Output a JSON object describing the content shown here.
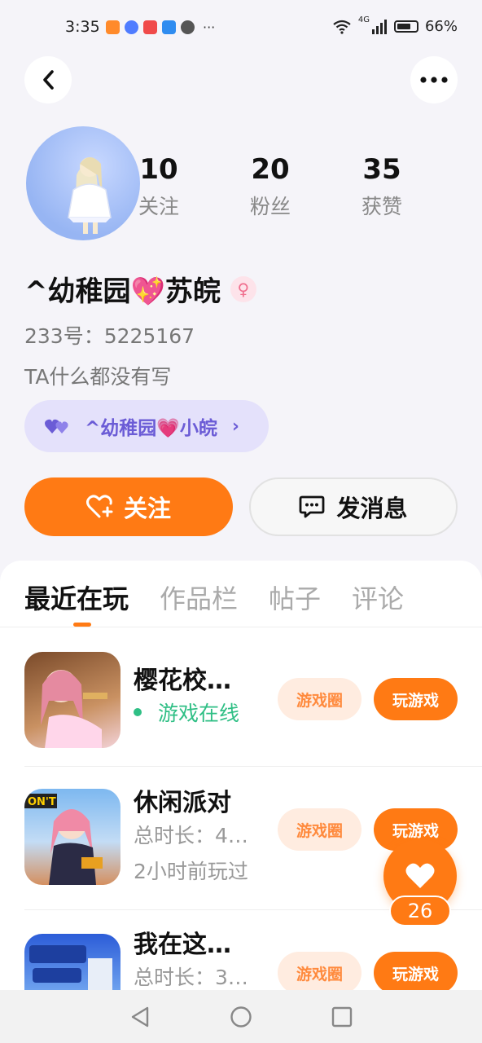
{
  "status_bar": {
    "time": "3:35",
    "more": "···",
    "network": "4G",
    "battery": "66%"
  },
  "profile": {
    "stats": [
      {
        "value": "10",
        "label": "关注"
      },
      {
        "value": "20",
        "label": "粉丝"
      },
      {
        "value": "35",
        "label": "获赞"
      }
    ],
    "nickname": "^幼稚园💖苏皖",
    "uid": "233号：5225167",
    "bio": "TA什么都没有写",
    "fan_badge": "^幼稚园💗小皖"
  },
  "actions": {
    "follow_label": "关注",
    "message_label": "发消息"
  },
  "tabs": [
    {
      "label": "最近在玩"
    },
    {
      "label": "作品栏"
    },
    {
      "label": "帖子"
    },
    {
      "label": "评论"
    }
  ],
  "games": [
    {
      "name": "樱花校…",
      "status": "游戏在线",
      "circle_label": "游戏圈",
      "play_label": "玩游戏"
    },
    {
      "name": "休闲派对",
      "duration": "总时长：4…",
      "last_played": "2小时前玩过",
      "circle_label": "游戏圈",
      "play_label": "玩游戏"
    },
    {
      "name": "我在这…",
      "duration": "总时长：3…",
      "circle_label": "游戏圈",
      "play_label": "玩游戏"
    }
  ],
  "like": {
    "count": "26"
  },
  "colors": {
    "accent": "#ff7a14",
    "online": "#2fbf85",
    "badge": "#e4e1fb"
  }
}
